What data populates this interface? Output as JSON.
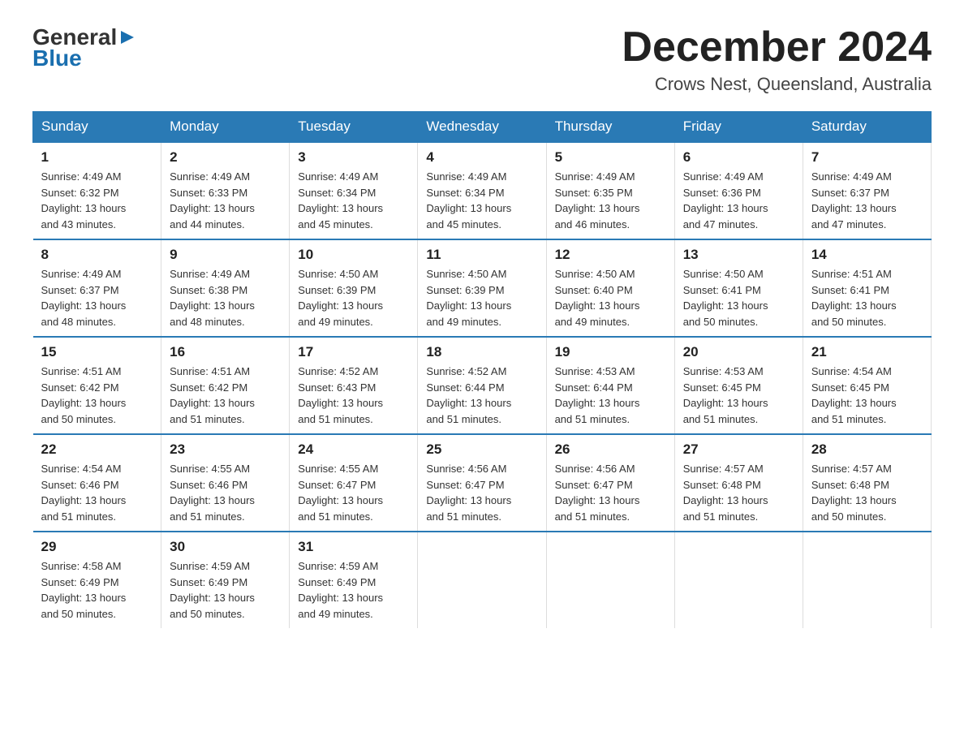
{
  "header": {
    "logo_general": "General",
    "logo_blue": "Blue",
    "title": "December 2024",
    "subtitle": "Crows Nest, Queensland, Australia"
  },
  "days_of_week": [
    "Sunday",
    "Monday",
    "Tuesday",
    "Wednesday",
    "Thursday",
    "Friday",
    "Saturday"
  ],
  "weeks": [
    [
      {
        "day": "1",
        "sunrise": "4:49 AM",
        "sunset": "6:32 PM",
        "daylight": "13 hours and 43 minutes."
      },
      {
        "day": "2",
        "sunrise": "4:49 AM",
        "sunset": "6:33 PM",
        "daylight": "13 hours and 44 minutes."
      },
      {
        "day": "3",
        "sunrise": "4:49 AM",
        "sunset": "6:34 PM",
        "daylight": "13 hours and 45 minutes."
      },
      {
        "day": "4",
        "sunrise": "4:49 AM",
        "sunset": "6:34 PM",
        "daylight": "13 hours and 45 minutes."
      },
      {
        "day": "5",
        "sunrise": "4:49 AM",
        "sunset": "6:35 PM",
        "daylight": "13 hours and 46 minutes."
      },
      {
        "day": "6",
        "sunrise": "4:49 AM",
        "sunset": "6:36 PM",
        "daylight": "13 hours and 47 minutes."
      },
      {
        "day": "7",
        "sunrise": "4:49 AM",
        "sunset": "6:37 PM",
        "daylight": "13 hours and 47 minutes."
      }
    ],
    [
      {
        "day": "8",
        "sunrise": "4:49 AM",
        "sunset": "6:37 PM",
        "daylight": "13 hours and 48 minutes."
      },
      {
        "day": "9",
        "sunrise": "4:49 AM",
        "sunset": "6:38 PM",
        "daylight": "13 hours and 48 minutes."
      },
      {
        "day": "10",
        "sunrise": "4:50 AM",
        "sunset": "6:39 PM",
        "daylight": "13 hours and 49 minutes."
      },
      {
        "day": "11",
        "sunrise": "4:50 AM",
        "sunset": "6:39 PM",
        "daylight": "13 hours and 49 minutes."
      },
      {
        "day": "12",
        "sunrise": "4:50 AM",
        "sunset": "6:40 PM",
        "daylight": "13 hours and 49 minutes."
      },
      {
        "day": "13",
        "sunrise": "4:50 AM",
        "sunset": "6:41 PM",
        "daylight": "13 hours and 50 minutes."
      },
      {
        "day": "14",
        "sunrise": "4:51 AM",
        "sunset": "6:41 PM",
        "daylight": "13 hours and 50 minutes."
      }
    ],
    [
      {
        "day": "15",
        "sunrise": "4:51 AM",
        "sunset": "6:42 PM",
        "daylight": "13 hours and 50 minutes."
      },
      {
        "day": "16",
        "sunrise": "4:51 AM",
        "sunset": "6:42 PM",
        "daylight": "13 hours and 51 minutes."
      },
      {
        "day": "17",
        "sunrise": "4:52 AM",
        "sunset": "6:43 PM",
        "daylight": "13 hours and 51 minutes."
      },
      {
        "day": "18",
        "sunrise": "4:52 AM",
        "sunset": "6:44 PM",
        "daylight": "13 hours and 51 minutes."
      },
      {
        "day": "19",
        "sunrise": "4:53 AM",
        "sunset": "6:44 PM",
        "daylight": "13 hours and 51 minutes."
      },
      {
        "day": "20",
        "sunrise": "4:53 AM",
        "sunset": "6:45 PM",
        "daylight": "13 hours and 51 minutes."
      },
      {
        "day": "21",
        "sunrise": "4:54 AM",
        "sunset": "6:45 PM",
        "daylight": "13 hours and 51 minutes."
      }
    ],
    [
      {
        "day": "22",
        "sunrise": "4:54 AM",
        "sunset": "6:46 PM",
        "daylight": "13 hours and 51 minutes."
      },
      {
        "day": "23",
        "sunrise": "4:55 AM",
        "sunset": "6:46 PM",
        "daylight": "13 hours and 51 minutes."
      },
      {
        "day": "24",
        "sunrise": "4:55 AM",
        "sunset": "6:47 PM",
        "daylight": "13 hours and 51 minutes."
      },
      {
        "day": "25",
        "sunrise": "4:56 AM",
        "sunset": "6:47 PM",
        "daylight": "13 hours and 51 minutes."
      },
      {
        "day": "26",
        "sunrise": "4:56 AM",
        "sunset": "6:47 PM",
        "daylight": "13 hours and 51 minutes."
      },
      {
        "day": "27",
        "sunrise": "4:57 AM",
        "sunset": "6:48 PM",
        "daylight": "13 hours and 51 minutes."
      },
      {
        "day": "28",
        "sunrise": "4:57 AM",
        "sunset": "6:48 PM",
        "daylight": "13 hours and 50 minutes."
      }
    ],
    [
      {
        "day": "29",
        "sunrise": "4:58 AM",
        "sunset": "6:49 PM",
        "daylight": "13 hours and 50 minutes."
      },
      {
        "day": "30",
        "sunrise": "4:59 AM",
        "sunset": "6:49 PM",
        "daylight": "13 hours and 50 minutes."
      },
      {
        "day": "31",
        "sunrise": "4:59 AM",
        "sunset": "6:49 PM",
        "daylight": "13 hours and 49 minutes."
      },
      null,
      null,
      null,
      null
    ]
  ]
}
